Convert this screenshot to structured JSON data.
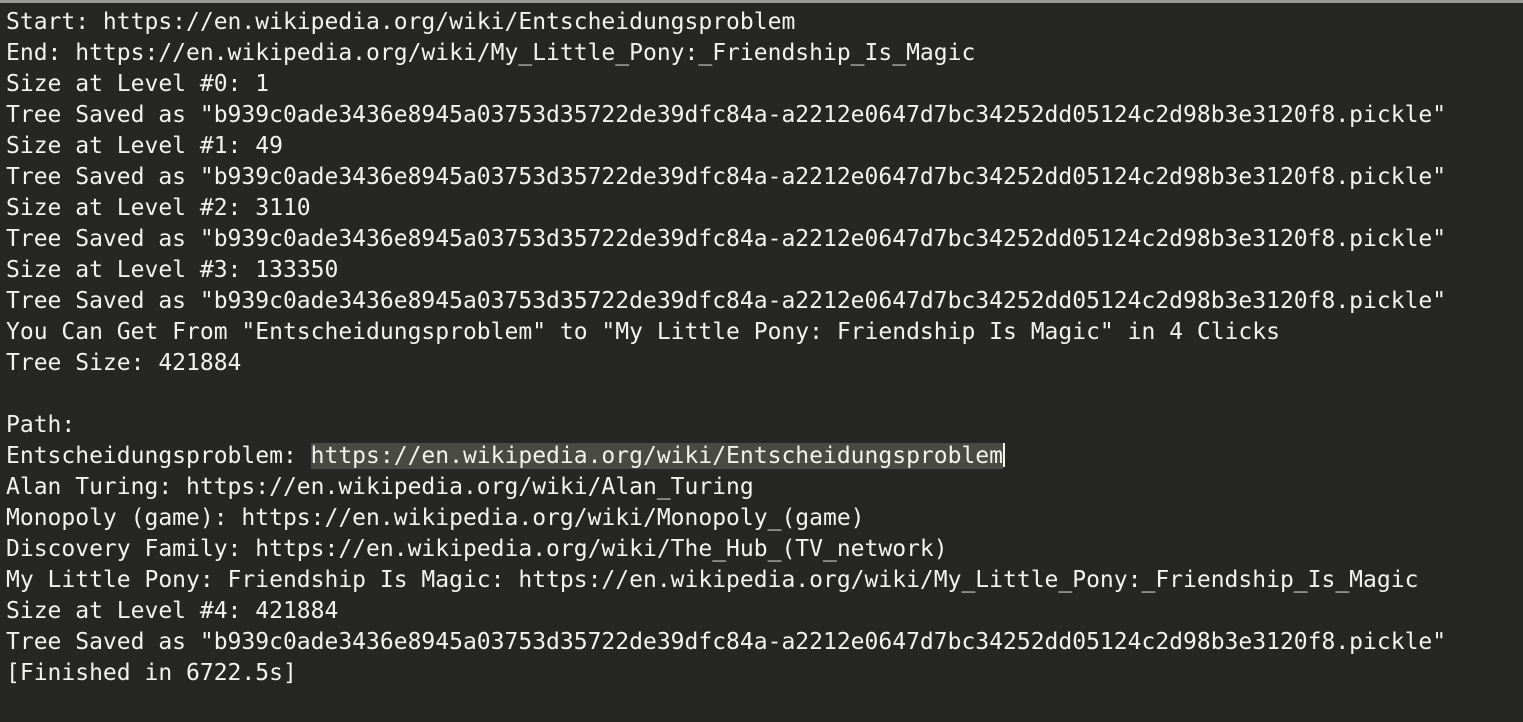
{
  "console": {
    "lines": [
      "Start: https://en.wikipedia.org/wiki/Entscheidungsproblem",
      "End: https://en.wikipedia.org/wiki/My_Little_Pony:_Friendship_Is_Magic",
      "Size at Level #0: 1",
      "Tree Saved as \"b939c0ade3436e8945a03753d35722de39dfc84a-a2212e0647d7bc34252dd05124c2d98b3e3120f8.pickle\"",
      "Size at Level #1: 49",
      "Tree Saved as \"b939c0ade3436e8945a03753d35722de39dfc84a-a2212e0647d7bc34252dd05124c2d98b3e3120f8.pickle\"",
      "Size at Level #2: 3110",
      "Tree Saved as \"b939c0ade3436e8945a03753d35722de39dfc84a-a2212e0647d7bc34252dd05124c2d98b3e3120f8.pickle\"",
      "Size at Level #3: 133350",
      "Tree Saved as \"b939c0ade3436e8945a03753d35722de39dfc84a-a2212e0647d7bc34252dd05124c2d98b3e3120f8.pickle\"",
      "You Can Get From \"Entscheidungsproblem\" to \"My Little Pony: Friendship Is Magic\" in 4 Clicks",
      "Tree Size: 421884",
      "",
      "Path:"
    ],
    "selected_line": {
      "prefix": "Entscheidungsproblem: ",
      "selected": "https://en.wikipedia.org/wiki/Entscheidungsproblem"
    },
    "lines_after": [
      "Alan Turing: https://en.wikipedia.org/wiki/Alan_Turing",
      "Monopoly (game): https://en.wikipedia.org/wiki/Monopoly_(game)",
      "Discovery Family: https://en.wikipedia.org/wiki/The_Hub_(TV_network)",
      "My Little Pony: Friendship Is Magic: https://en.wikipedia.org/wiki/My_Little_Pony:_Friendship_Is_Magic",
      "Size at Level #4: 421884",
      "Tree Saved as \"b939c0ade3436e8945a03753d35722de39dfc84a-a2212e0647d7bc34252dd05124c2d98b3e3120f8.pickle\"",
      "[Finished in 6722.5s]"
    ]
  }
}
